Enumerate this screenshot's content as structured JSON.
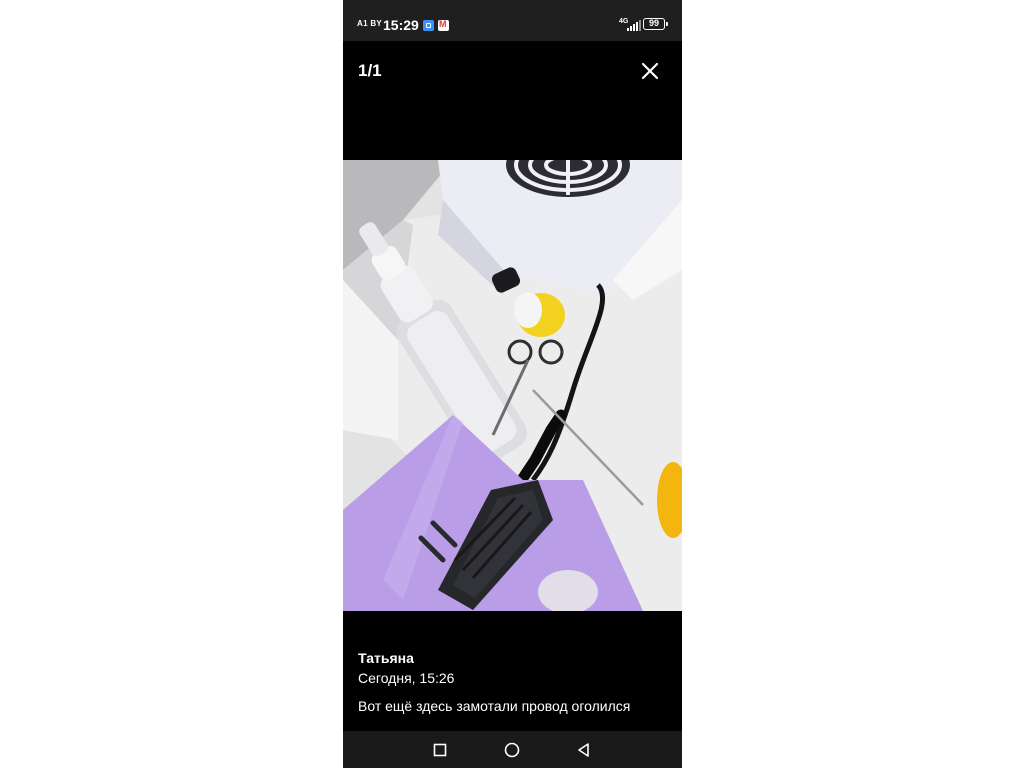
{
  "status_bar": {
    "carrier": "A1 BY",
    "time": "15:29",
    "network": "4G",
    "battery": "99",
    "icons": [
      "app-notification-icon",
      "mail-icon",
      "signal-icon",
      "battery-icon"
    ]
  },
  "viewer": {
    "counter": "1/1",
    "close_icon": "close-icon"
  },
  "message": {
    "sender": "Татьяна",
    "timestamp": "Сегодня, 15:26",
    "text": "Вот ещё здесь замотали провод оголился"
  },
  "nav_bar": {
    "icons": [
      "recent-apps-icon",
      "home-icon",
      "back-icon"
    ]
  },
  "colors": {
    "background": "#000000",
    "status_bar": "#1f1f1f",
    "nav_bar": "#1a1a1a",
    "text": "#ffffff"
  }
}
